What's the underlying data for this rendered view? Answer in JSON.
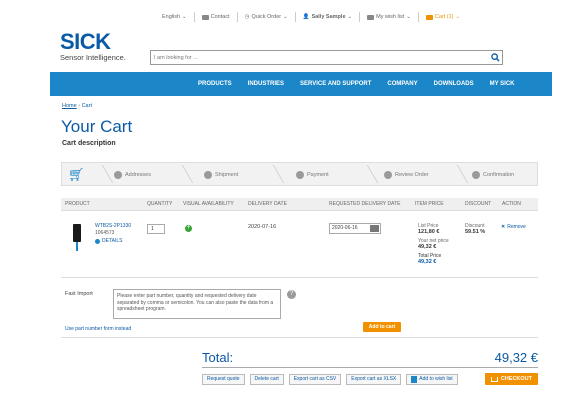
{
  "topbar": {
    "language": "English",
    "contact": "Contact",
    "quick_order": "Quick Order",
    "user": "Sally Sample",
    "wishlist": "My wish list",
    "cart": "Cart (1)"
  },
  "brand": {
    "name": "SICK",
    "tagline": "Sensor Intelligence."
  },
  "search": {
    "placeholder": "I am looking for ..."
  },
  "nav": {
    "items": [
      "PRODUCTS",
      "INDUSTRIES",
      "SERVICE AND SUPPORT",
      "COMPANY",
      "DOWNLOADS",
      "MY SICK"
    ]
  },
  "breadcrumb": {
    "home": "Home",
    "sep": "›",
    "current": "Cart"
  },
  "page": {
    "title": "Your Cart",
    "description": "Cart description"
  },
  "steps": [
    "Addresses",
    "Shipment",
    "Payment",
    "Review Order",
    "Confirmation"
  ],
  "table": {
    "headers": [
      "PRODUCT",
      "QUANTITY",
      "VISUAL AVAILABILITY",
      "DELIVERY DATE",
      "REQUESTED DELIVERY DATE",
      "ITEM PRICE",
      "DISCOUNT",
      "ACTION"
    ],
    "row": {
      "part_number": "WTB2S-2P1330",
      "product_id": "1064573",
      "details": "DETAILS",
      "quantity": "1",
      "delivery_date": "2020-07-16",
      "requested_date": "2020-06-16",
      "list_price_label": "List Price",
      "list_price": "121,80 €",
      "net_price_label": "Your net price",
      "net_price": "49,32 €",
      "total_price_label": "Total Price",
      "total_price": "49,32 €",
      "discount_label": "Discount",
      "discount": "59.51 %",
      "remove": "Remove"
    }
  },
  "fast_import": {
    "label": "Fast Import",
    "text": "Please enter part number, quantity and requested delivery date separated by comma or semicolon. You can also paste the data from a spreadsheet program.",
    "link": "Use part number form instead",
    "add_button": "Add to cart"
  },
  "total": {
    "label": "Total:",
    "value": "49,32 €"
  },
  "actions": {
    "request_quote": "Request quote",
    "delete_cart": "Delete cart",
    "export_csv": "Export cart as CSV",
    "export_xlsx": "Export cart as XLSX",
    "add_wishlist": "Add to wish list",
    "checkout": "CHECKOUT"
  }
}
